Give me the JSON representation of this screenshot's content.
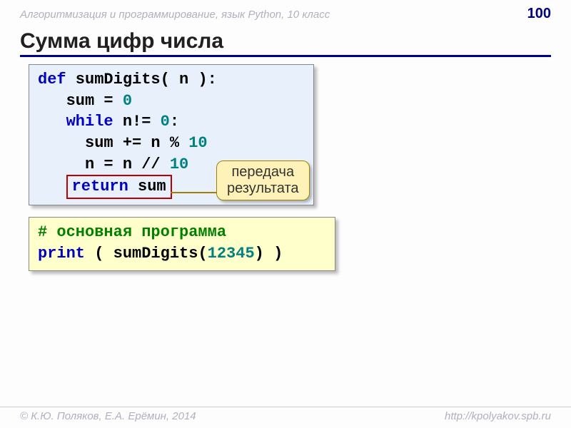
{
  "header": {
    "course": "Алгоритмизация и программирование, язык Python, 10 класс",
    "page": "100"
  },
  "title": "Сумма цифр числа",
  "code1": {
    "l1": {
      "kw": "def",
      "rest": " sumDigits( n ):"
    },
    "l2": {
      "pre": "   sum = ",
      "n": "0"
    },
    "l3": {
      "kw": "while",
      "mid": " n!= ",
      "n": "0",
      "post": ":"
    },
    "l4": {
      "pre": "     sum += n % ",
      "n": "10"
    },
    "l5": {
      "pre": "     n = n // ",
      "n": "10"
    },
    "l6": {
      "kw": "return",
      "rest": " sum"
    }
  },
  "callout": {
    "l1": "передача",
    "l2": "результата"
  },
  "code2": {
    "l1": "# основная программа",
    "l2": {
      "kw": "print",
      "pre": " ( sumDigits(",
      "n": "12345",
      "post": ") )"
    }
  },
  "footer": {
    "left": "© К.Ю. Поляков, Е.А. Ерёмин, 2014",
    "right": "http://kpolyakov.spb.ru"
  }
}
